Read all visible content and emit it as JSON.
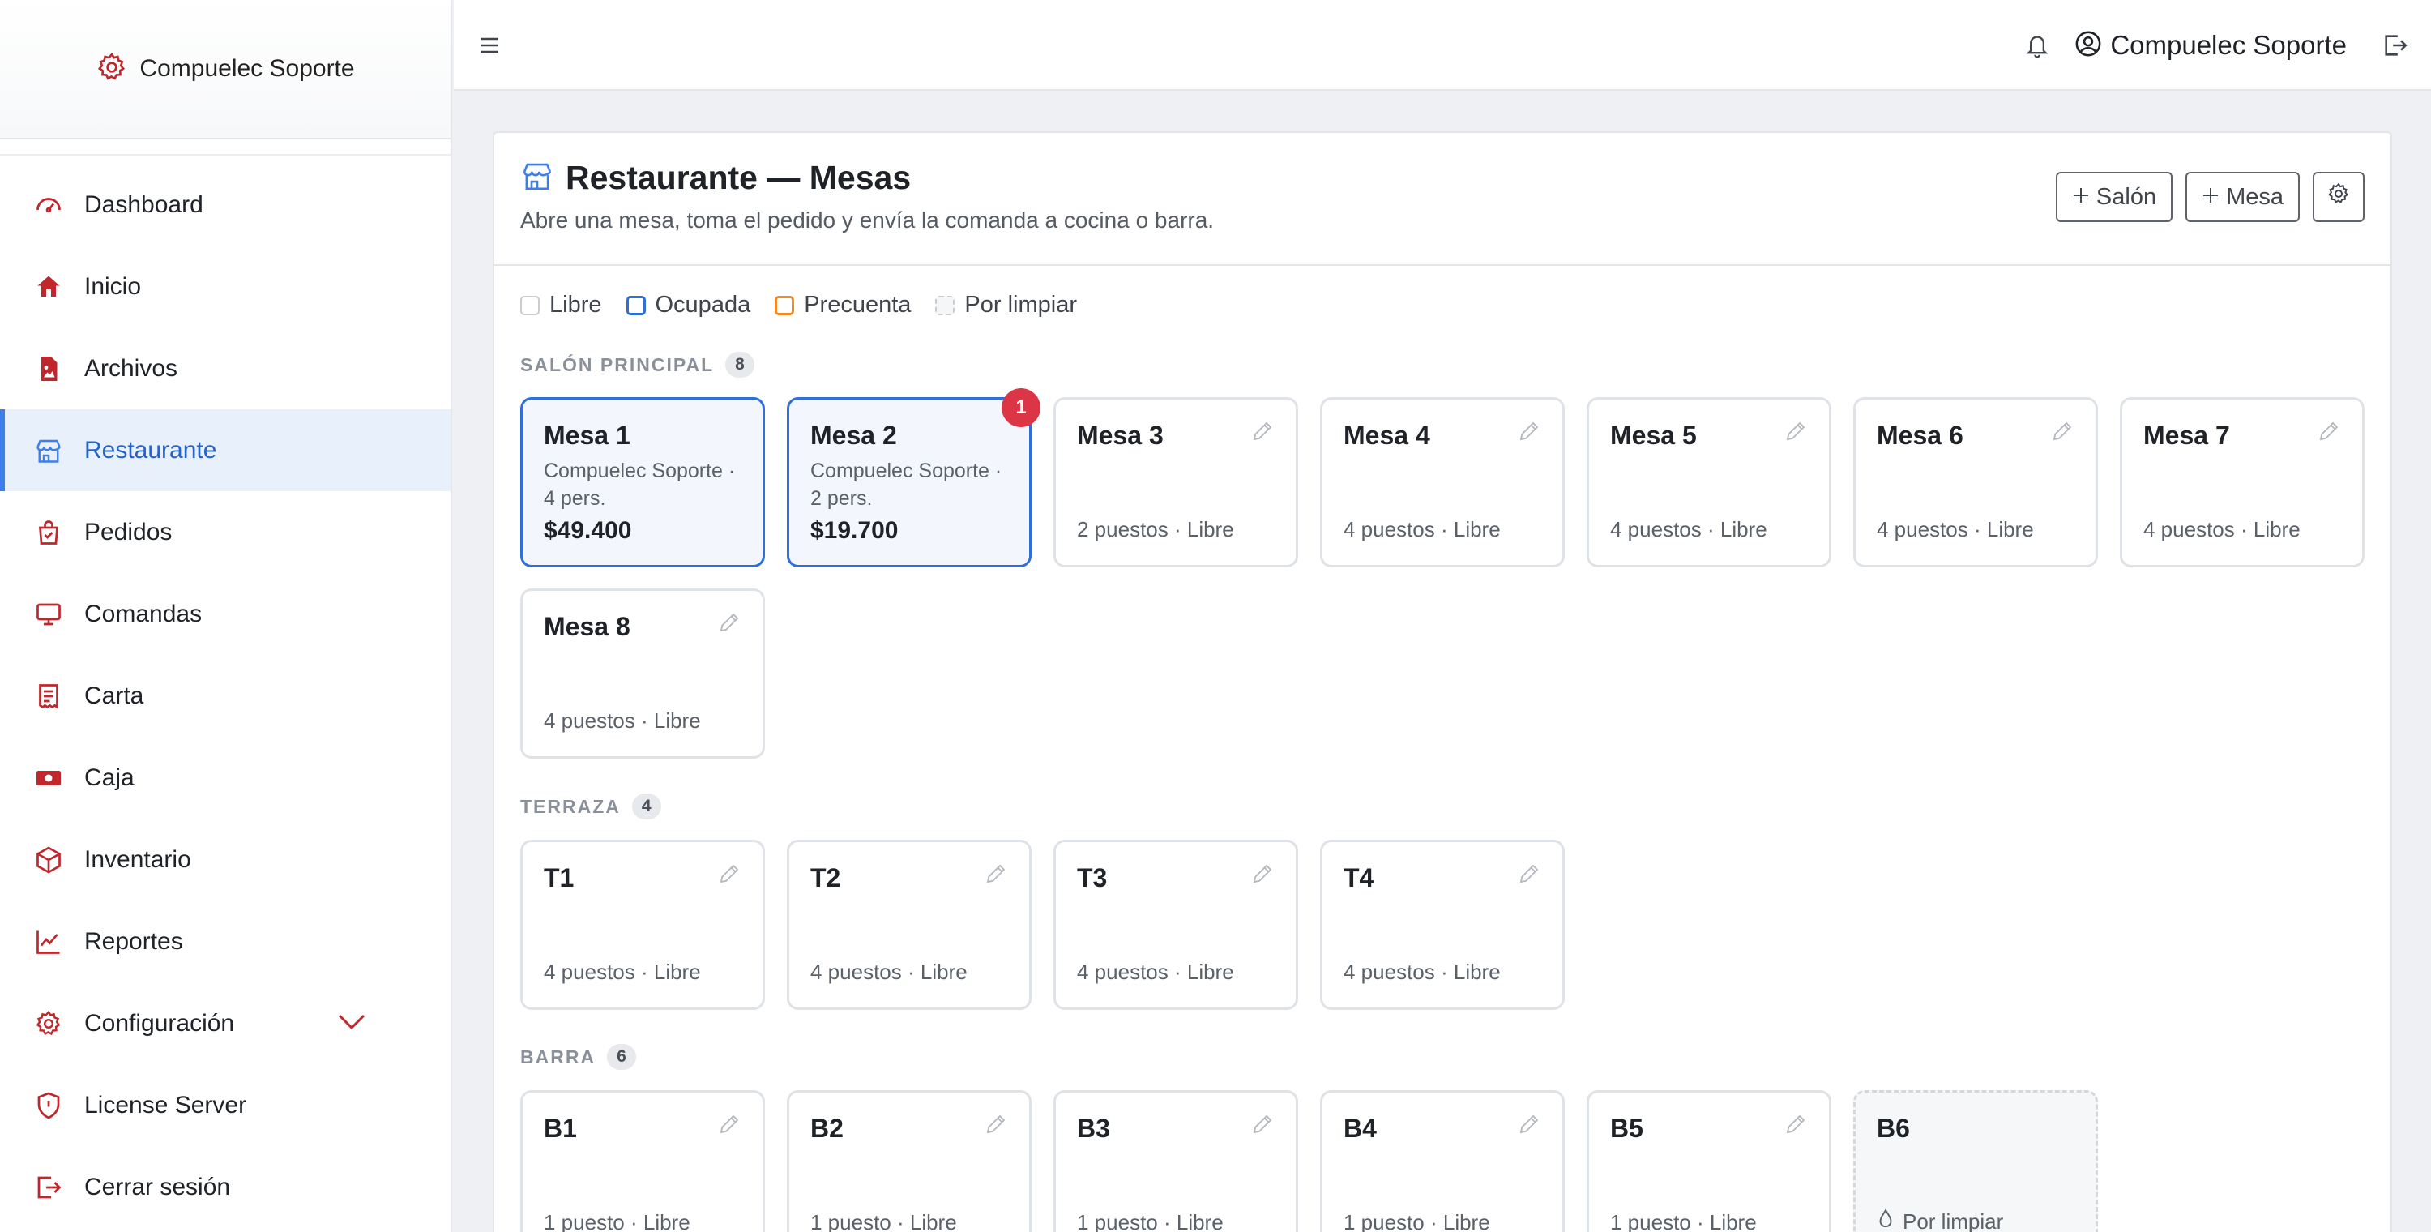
{
  "app": {
    "brand": "Compuelec Soporte"
  },
  "sidebar": {
    "items": [
      {
        "label": "Dashboard",
        "icon": "gauge-icon"
      },
      {
        "label": "Inicio",
        "icon": "home-icon"
      },
      {
        "label": "Archivos",
        "icon": "file-image-icon"
      },
      {
        "label": "Restaurante",
        "icon": "shop-icon",
        "active": true
      },
      {
        "label": "Pedidos",
        "icon": "bag-check-icon"
      },
      {
        "label": "Comandas",
        "icon": "monitor-icon"
      },
      {
        "label": "Carta",
        "icon": "receipt-icon"
      },
      {
        "label": "Caja",
        "icon": "cash-icon"
      },
      {
        "label": "Inventario",
        "icon": "box-icon"
      },
      {
        "label": "Reportes",
        "icon": "chart-line-icon"
      },
      {
        "label": "Configuración",
        "icon": "gear-icon"
      },
      {
        "label": "License Server",
        "icon": "shield-icon"
      },
      {
        "label": "Cerrar sesión",
        "icon": "logout-icon"
      }
    ]
  },
  "topbar": {
    "user_name": "Compuelec Soporte"
  },
  "page": {
    "title": "Restaurante — Mesas",
    "subtitle": "Abre una mesa, toma el pedido y envía la comanda a cocina o barra.",
    "buttons": {
      "add_salon": "Salón",
      "add_mesa": "Mesa"
    }
  },
  "legend": {
    "libre": "Libre",
    "ocupada": "Ocupada",
    "precuenta": "Precuenta",
    "por_limpiar": "Por limpiar"
  },
  "sections": [
    {
      "title": "SALÓN PRINCIPAL",
      "count": "8",
      "tables": [
        {
          "name": "Mesa 1",
          "status": "busy",
          "customer": "Compuelec Soporte ·",
          "people": "4 pers.",
          "total": "$49.400"
        },
        {
          "name": "Mesa 2",
          "status": "busy",
          "customer": "Compuelec Soporte ·",
          "people": "2 pers.",
          "total": "$19.700",
          "badge": "1"
        },
        {
          "name": "Mesa 3",
          "status": "free",
          "info": "2 puestos · Libre"
        },
        {
          "name": "Mesa 4",
          "status": "free",
          "info": "4 puestos · Libre"
        },
        {
          "name": "Mesa 5",
          "status": "free",
          "info": "4 puestos · Libre"
        },
        {
          "name": "Mesa 6",
          "status": "free",
          "info": "4 puestos · Libre"
        },
        {
          "name": "Mesa 7",
          "status": "free",
          "info": "4 puestos · Libre"
        },
        {
          "name": "Mesa 8",
          "status": "free",
          "info": "4 puestos · Libre"
        }
      ]
    },
    {
      "title": "TERRAZA",
      "count": "4",
      "tables": [
        {
          "name": "T1",
          "status": "free",
          "info": "4 puestos · Libre"
        },
        {
          "name": "T2",
          "status": "free",
          "info": "4 puestos · Libre"
        },
        {
          "name": "T3",
          "status": "free",
          "info": "4 puestos · Libre"
        },
        {
          "name": "T4",
          "status": "free",
          "info": "4 puestos · Libre"
        }
      ]
    },
    {
      "title": "BARRA",
      "count": "6",
      "tables": [
        {
          "name": "B1",
          "status": "free",
          "info": "1 puesto · Libre"
        },
        {
          "name": "B2",
          "status": "free",
          "info": "1 puesto · Libre"
        },
        {
          "name": "B3",
          "status": "free",
          "info": "1 puesto · Libre"
        },
        {
          "name": "B4",
          "status": "free",
          "info": "1 puesto · Libre"
        },
        {
          "name": "B5",
          "status": "free",
          "info": "1 puesto · Libre"
        },
        {
          "name": "B6",
          "status": "dirty",
          "info": "Por limpiar"
        }
      ]
    }
  ],
  "colors": {
    "accent": "#2f6fdb",
    "sidebar_icon": "#c0272d",
    "precuenta": "#f08a24",
    "badge": "#dc3545"
  }
}
